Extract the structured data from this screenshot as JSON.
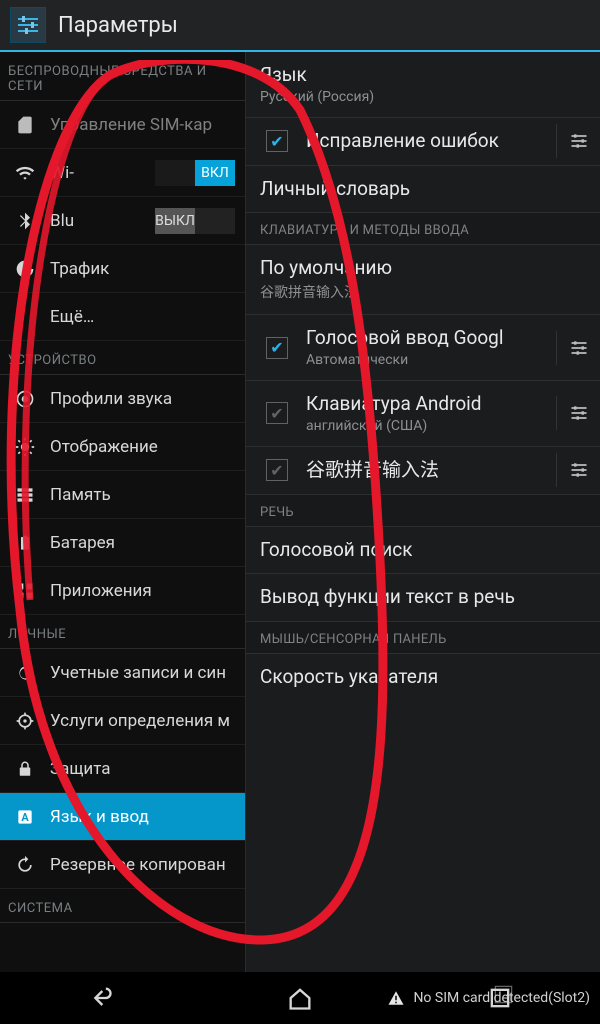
{
  "header": {
    "title": "Параметры"
  },
  "left": {
    "cat_wireless": "БЕСПРОВОДНЫЕ СРЕДСТВА И СЕТИ",
    "sim": "Управление SIM-кар",
    "wifi": "Wi-",
    "bt": "Blu",
    "traffic": "Трафик",
    "more": "Ещё…",
    "cat_device": "УСТРОЙСТВО",
    "sound": "Профили звука",
    "display": "Отображение",
    "memory": "Память",
    "battery": "Батарея",
    "apps": "Приложения",
    "cat_personal": "ЛИЧНЫЕ",
    "accounts": "Учетные записи и син",
    "location": "Услуги определения м",
    "security": "Защита",
    "language": "Язык и ввод",
    "backup": "Резервное копирован",
    "cat_system": "СИСТЕМА",
    "sw_on": "ВКЛ",
    "sw_off": "ВЫКЛ"
  },
  "right": {
    "lang_title": "Язык",
    "lang_sub": "Русский (Россия)",
    "spellcheck": "Исправление ошибок",
    "dict": "Личный словарь",
    "cat_keyboard": "КЛАВИАТУРА И МЕТОДЫ ВВОДА",
    "default_title": "По умолчанию",
    "default_sub": "谷歌拼音输入法",
    "gv_title": "Голосовой ввод Googl",
    "gv_sub": "Автоматически",
    "akb_title": "Клавиатура Android",
    "akb_sub": "английский (США)",
    "pinyin_title": "谷歌拼音输入法",
    "cat_speech": "РЕЧЬ",
    "voice_search": "Голосовой поиск",
    "tts": "Вывод функции текст в речь",
    "cat_mouse": "МЫШЬ/СЕНСОРНАЯ ПАНЕЛЬ",
    "pointer": "Скорость указателя"
  },
  "statusbar": {
    "nosim": "No SIM card detected(Slot2)"
  }
}
